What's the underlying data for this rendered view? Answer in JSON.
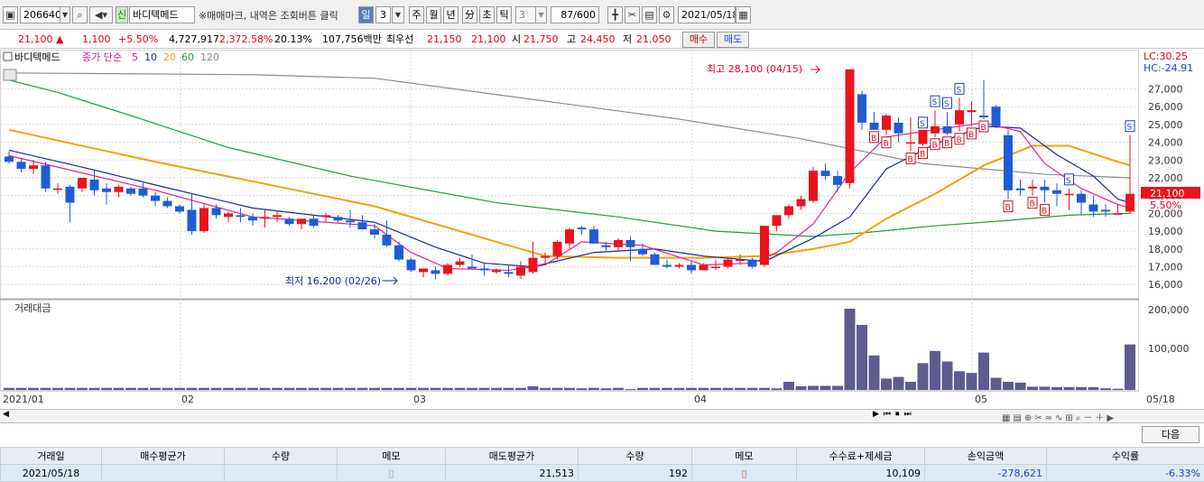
{
  "toolbar": {
    "code": "206640",
    "badge": "신",
    "name": "바디텍메드",
    "hint": "※매매마크, 내역은 조회버튼 클릭",
    "periods": [
      "일",
      "3",
      "주",
      "월",
      "년",
      "分",
      "초",
      "틱"
    ],
    "tick_val": "3",
    "count": "87/600",
    "date": "2021/05/18"
  },
  "quote": {
    "price": "21,100",
    "arrow": "▲",
    "change": "1,100",
    "pct": "+5.50%",
    "volume": "4,727,917",
    "vol_ratio": "2,372.58%",
    "turnover": "20.13%",
    "amount": "107,756백만",
    "best_label": "최우선",
    "ask": "21,150",
    "bid": "21,100",
    "open_label": "시",
    "open": "21,750",
    "high_label": "고",
    "high": "24,450",
    "low_label": "저",
    "low": "21,050",
    "buy": "매수",
    "sell": "매도"
  },
  "legend": {
    "name": "바디텍메드",
    "ma_label": "종가 단순",
    "ma": [
      "5",
      "10",
      "20",
      "60",
      "120"
    ]
  },
  "colors": {
    "up": "#e8141e",
    "down": "#1f5cd6",
    "ma5": "#d8249a",
    "ma10": "#1a2a8e",
    "ma20": "#efa30c",
    "ma60": "#26993c",
    "ma120": "#8c8c8c",
    "vol": "#5e5c8e"
  },
  "chart_data": {
    "type": "candlestick",
    "ylim": [
      15400,
      28600
    ],
    "y_ticks": [
      "27,000",
      "26,000",
      "25,000",
      "24,000",
      "23,000",
      "22,000",
      "21,000",
      "20,000",
      "19,000",
      "18,000",
      "17,000",
      "16,000"
    ],
    "x_labels": [
      "2021/01",
      "02",
      "03",
      "04",
      "05",
      "05/18"
    ],
    "lc": "LC:30.25",
    "hc": "HC:-24.91",
    "price_tag": "21,100",
    "pct_tag": "5.50%",
    "max_label": "최고 28,100 (04/15)",
    "min_label": "최저 16,200 (02/26)",
    "vol_title": "거래대금",
    "vol_ticks": [
      "200,000",
      "100,000"
    ],
    "ohlc": [
      [
        23200,
        23500,
        22800,
        22900
      ],
      [
        22900,
        23100,
        22300,
        22500
      ],
      [
        22500,
        23000,
        22200,
        22700
      ],
      [
        22700,
        22900,
        21200,
        21400
      ],
      [
        21400,
        21700,
        21100,
        21400
      ],
      [
        21500,
        21600,
        19500,
        20600
      ],
      [
        21400,
        22000,
        21200,
        22000
      ],
      [
        21900,
        22400,
        21000,
        21300
      ],
      [
        21400,
        21700,
        20500,
        21200
      ],
      [
        21200,
        21600,
        20900,
        21500
      ],
      [
        21400,
        21500,
        21000,
        21100
      ],
      [
        21400,
        21700,
        20900,
        21000
      ],
      [
        21000,
        21200,
        20400,
        20700
      ],
      [
        20700,
        20900,
        20300,
        20400
      ],
      [
        20400,
        20500,
        20000,
        20100
      ],
      [
        20200,
        21100,
        18800,
        19000
      ],
      [
        19000,
        20500,
        18900,
        20300
      ],
      [
        20300,
        20500,
        19700,
        19900
      ],
      [
        19800,
        20100,
        19500,
        20000
      ],
      [
        19900,
        20300,
        19500,
        19800
      ],
      [
        19800,
        20000,
        19300,
        19600
      ],
      [
        19700,
        20200,
        19200,
        19800
      ],
      [
        19800,
        20100,
        19500,
        19900
      ],
      [
        19700,
        19800,
        19300,
        19400
      ],
      [
        19400,
        19700,
        19100,
        19700
      ],
      [
        19700,
        19900,
        19200,
        19300
      ],
      [
        19800,
        20000,
        19500,
        19900
      ],
      [
        19800,
        19900,
        19500,
        19600
      ],
      [
        19600,
        20200,
        19200,
        19500
      ],
      [
        19500,
        19900,
        19100,
        19100
      ],
      [
        19100,
        19400,
        18600,
        18800
      ],
      [
        18800,
        19600,
        18100,
        18200
      ],
      [
        18200,
        18400,
        17300,
        17400
      ],
      [
        17400,
        17500,
        16700,
        16800
      ],
      [
        16700,
        16900,
        16400,
        16900
      ],
      [
        16800,
        17000,
        16300,
        16600
      ],
      [
        16600,
        17200,
        16500,
        17100
      ],
      [
        17100,
        17500,
        17000,
        17300
      ],
      [
        17000,
        17700,
        16900,
        16900
      ],
      [
        16900,
        17200,
        16500,
        16800
      ],
      [
        16700,
        16900,
        16600,
        16800
      ],
      [
        16700,
        17100,
        16400,
        16600
      ],
      [
        16500,
        17300,
        16300,
        17000
      ],
      [
        16700,
        18400,
        16600,
        17500
      ],
      [
        17500,
        17800,
        17200,
        17600
      ],
      [
        17600,
        18500,
        17400,
        18400
      ],
      [
        18300,
        19200,
        18000,
        19100
      ],
      [
        19200,
        19300,
        18800,
        19100
      ],
      [
        19100,
        19300,
        18300,
        18300
      ],
      [
        18200,
        18400,
        17900,
        18100
      ],
      [
        18100,
        18600,
        17900,
        18500
      ],
      [
        18500,
        18700,
        17300,
        18100
      ],
      [
        18000,
        18300,
        17600,
        17700
      ],
      [
        17700,
        17800,
        17100,
        17100
      ],
      [
        17100,
        17400,
        16900,
        17000
      ],
      [
        17000,
        17200,
        16900,
        17100
      ],
      [
        17100,
        17300,
        16600,
        16800
      ],
      [
        16800,
        17200,
        16800,
        17100
      ],
      [
        17000,
        17400,
        16800,
        17000
      ],
      [
        17000,
        17500,
        16900,
        17400
      ],
      [
        17400,
        17700,
        17100,
        17400
      ],
      [
        17400,
        17500,
        16900,
        17000
      ],
      [
        17100,
        19300,
        17000,
        19300
      ],
      [
        19300,
        19900,
        19000,
        19900
      ],
      [
        19900,
        20500,
        19700,
        20400
      ],
      [
        20400,
        21000,
        20200,
        20800
      ],
      [
        20700,
        22600,
        20600,
        22400
      ],
      [
        22400,
        22800,
        21900,
        22100
      ],
      [
        22100,
        22400,
        21200,
        21600
      ],
      [
        21700,
        28100,
        21400,
        28100
      ],
      [
        26700,
        26900,
        24700,
        25100
      ],
      [
        25100,
        25700,
        24700,
        24700
      ],
      [
        24700,
        25600,
        24400,
        25500
      ],
      [
        25100,
        25400,
        24000,
        24500
      ],
      [
        24000,
        25400,
        23500,
        24000
      ],
      [
        23900,
        24600,
        23800,
        24700
      ],
      [
        24500,
        25800,
        24300,
        24900
      ],
      [
        24900,
        25700,
        24400,
        24500
      ],
      [
        25000,
        26500,
        24600,
        25800
      ],
      [
        25700,
        26300,
        24900,
        25800
      ],
      [
        25500,
        27500,
        25300,
        25400
      ],
      [
        26000,
        26100,
        24800,
        24900
      ],
      [
        24400,
        24700,
        20800,
        21300
      ],
      [
        21400,
        21900,
        21000,
        21300
      ],
      [
        21400,
        21900,
        21000,
        21500
      ],
      [
        21500,
        21900,
        20600,
        21300
      ],
      [
        21300,
        21700,
        20400,
        21100
      ],
      [
        21100,
        21400,
        20200,
        21100
      ],
      [
        21100,
        21300,
        19900,
        20600
      ],
      [
        20500,
        21000,
        19800,
        20100
      ],
      [
        20200,
        20500,
        19800,
        20100
      ],
      [
        20000,
        20500,
        19900,
        20000
      ],
      [
        20100,
        24400,
        20000,
        21100
      ]
    ],
    "ma": {
      "5": [
        [
          0,
          23250
        ],
        [
          12,
          21300
        ],
        [
          20,
          19800
        ],
        [
          30,
          19300
        ],
        [
          33,
          17800
        ],
        [
          36,
          16900
        ],
        [
          41,
          16800
        ],
        [
          44,
          17100
        ],
        [
          47,
          18400
        ],
        [
          52,
          18200
        ],
        [
          57,
          17100
        ],
        [
          61,
          17200
        ],
        [
          63,
          17800
        ],
        [
          66,
          19400
        ],
        [
          69,
          22300
        ],
        [
          72,
          24300
        ],
        [
          76,
          24700
        ],
        [
          80,
          25100
        ],
        [
          83,
          24600
        ],
        [
          85,
          22800
        ],
        [
          88,
          21400
        ],
        [
          91,
          20500
        ],
        [
          92,
          20300
        ]
      ],
      "10": [
        [
          0,
          23550
        ],
        [
          6,
          22600
        ],
        [
          12,
          21600
        ],
        [
          20,
          20300
        ],
        [
          30,
          19500
        ],
        [
          35,
          18100
        ],
        [
          39,
          17200
        ],
        [
          43,
          17000
        ],
        [
          48,
          17800
        ],
        [
          53,
          18000
        ],
        [
          57,
          17600
        ],
        [
          62,
          17300
        ],
        [
          66,
          18600
        ],
        [
          69,
          19800
        ],
        [
          72,
          22500
        ],
        [
          76,
          23900
        ],
        [
          80,
          24900
        ],
        [
          83,
          24800
        ],
        [
          86,
          23300
        ],
        [
          89,
          22100
        ],
        [
          91,
          20800
        ],
        [
          92,
          20600
        ]
      ],
      "20": [
        [
          0,
          24700
        ],
        [
          6,
          23800
        ],
        [
          12,
          22900
        ],
        [
          20,
          21800
        ],
        [
          30,
          20400
        ],
        [
          38,
          18800
        ],
        [
          44,
          17600
        ],
        [
          50,
          17500
        ],
        [
          57,
          17500
        ],
        [
          62,
          17600
        ],
        [
          66,
          18000
        ],
        [
          69,
          18400
        ],
        [
          72,
          19700
        ],
        [
          76,
          21100
        ],
        [
          80,
          22700
        ],
        [
          84,
          23800
        ],
        [
          87,
          23800
        ],
        [
          91,
          22900
        ],
        [
          92,
          22700
        ]
      ],
      "60": [
        [
          0,
          27500
        ],
        [
          4,
          26800
        ],
        [
          10,
          25500
        ],
        [
          18,
          23700
        ],
        [
          28,
          22100
        ],
        [
          40,
          20600
        ],
        [
          50,
          19800
        ],
        [
          58,
          19000
        ],
        [
          66,
          18700
        ],
        [
          70,
          18900
        ],
        [
          76,
          19300
        ],
        [
          82,
          19600
        ],
        [
          87,
          19900
        ],
        [
          92,
          20000
        ]
      ],
      "120": [
        [
          0,
          27900
        ],
        [
          20,
          27800
        ],
        [
          30,
          27600
        ],
        [
          42,
          26500
        ],
        [
          55,
          25300
        ],
        [
          65,
          24200
        ],
        [
          75,
          22800
        ],
        [
          85,
          22200
        ],
        [
          92,
          22000
        ]
      ]
    },
    "volume": [
      5,
      5,
      5,
      5,
      5,
      5,
      5,
      5,
      5,
      5,
      5,
      5,
      5,
      5,
      5,
      5,
      5,
      5,
      5,
      5,
      5,
      5,
      5,
      5,
      5,
      5,
      5,
      5,
      5,
      5,
      5,
      5,
      5,
      5,
      5,
      5,
      5,
      5,
      5,
      5,
      5,
      5,
      5,
      5,
      5,
      5,
      5,
      5,
      5,
      5,
      5,
      5,
      5,
      5,
      5,
      5,
      5,
      5,
      5,
      5,
      5,
      5,
      5,
      5,
      5,
      5,
      5,
      5,
      5,
      5,
      5,
      5,
      5,
      5,
      5,
      5,
      5,
      5,
      5,
      5,
      5,
      5,
      5,
      5,
      5,
      5,
      5,
      5,
      5,
      5,
      5,
      5,
      5
    ],
    "vol_spikes": {
      "43": 9,
      "46": 5,
      "47": 4,
      "49": 4,
      "51": 2,
      "63": 4,
      "64": 20,
      "65": 9,
      "66": 10,
      "67": 10,
      "68": 10,
      "69": 200,
      "70": 160,
      "71": 85,
      "72": 28,
      "73": 32,
      "74": 20,
      "75": 66,
      "76": 96,
      "77": 70,
      "78": 46,
      "79": 42,
      "80": 92,
      "81": 30,
      "82": 20,
      "83": 18,
      "84": 8,
      "85": 8,
      "86": 7,
      "87": 7,
      "88": 7,
      "89": 7,
      "90": 4,
      "91": 3,
      "92": 112
    },
    "sell_marks": [
      75,
      76,
      77,
      78,
      87,
      92
    ],
    "buy_marks": [
      71,
      72,
      74,
      75,
      76,
      77,
      78,
      79,
      80,
      82,
      84,
      85
    ]
  },
  "table": {
    "headers": [
      "거래일",
      "매수평균가",
      "수량",
      "메모",
      "매도평균가",
      "수량",
      "메모",
      "수수료+제세금",
      "손익금액",
      "수익률"
    ],
    "row": [
      "2021/05/18",
      "",
      "",
      "",
      "21,513",
      "192",
      "",
      "10,109",
      "-278,621",
      "-6.33%"
    ],
    "next": "다음"
  }
}
